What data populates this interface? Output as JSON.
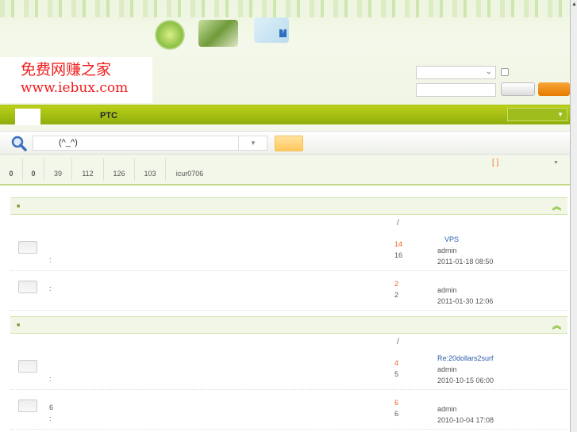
{
  "logo": {
    "line1": "免费网赚之家",
    "line2": "www.iebux.com"
  },
  "nav": {
    "ptc": "PTC"
  },
  "search": {
    "value": "(^_^)"
  },
  "stats": [
    "0",
    "0",
    "39",
    "112",
    "126",
    "103",
    "icur0706"
  ],
  "bracket": "[ ]",
  "sections": [
    {
      "slash": "/",
      "rows": [
        {
          "sub": ":",
          "line1": "",
          "num1": "14",
          "num2": "16",
          "last_title": "VPS",
          "last_user": "admin",
          "last_time": "2011-01-18 08:50"
        },
        {
          "sub": ":",
          "line1": "",
          "num1": "2",
          "num2": "2",
          "last_title": "",
          "last_user": "admin",
          "last_time": "2011-01-30 12:06"
        }
      ]
    },
    {
      "slash": "/",
      "rows": [
        {
          "sub": ":",
          "line1": "",
          "num1": "4",
          "num2": "5",
          "last_title": "Re:20dollars2surf",
          "last_user": "admin",
          "last_time": "2010-10-15 06:00"
        },
        {
          "sub": ":",
          "line1": "6",
          "num1": "6",
          "num2": "6",
          "last_title": "",
          "last_user": "admin",
          "last_time": "2010-10-04 17:08"
        }
      ]
    }
  ],
  "colors": {
    "nav": "#9dbb14",
    "accent": "#f07020",
    "link": "#2a5ea8"
  }
}
